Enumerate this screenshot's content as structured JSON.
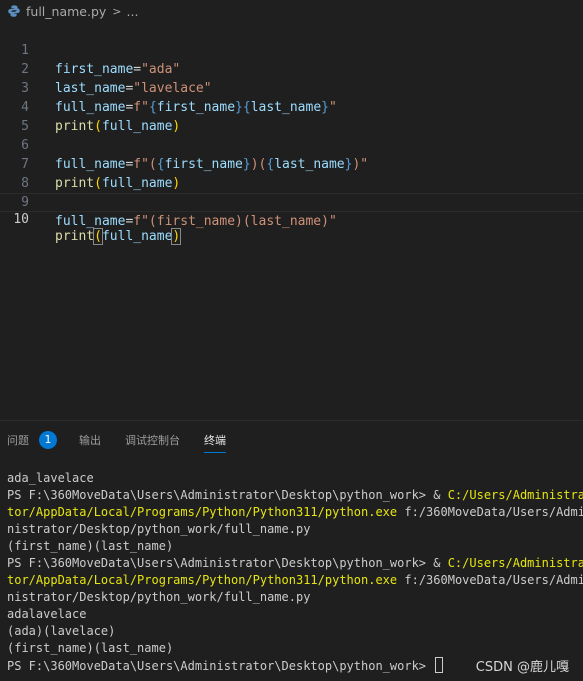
{
  "breadcrumb": {
    "file": "full_name.py",
    "chevron": ">",
    "more": "..."
  },
  "editor": {
    "line_numbers": [
      "1",
      "2",
      "3",
      "4",
      "5",
      "6",
      "7",
      "8",
      "9",
      "10"
    ],
    "lines": [
      [
        "first_name",
        "=",
        "\"ada\""
      ],
      [
        "last_name",
        "=",
        "\"lavelace\""
      ],
      [
        "full_name",
        "=",
        "f\"",
        "{",
        "first_name",
        "}",
        "{",
        "last_name",
        "}",
        "\""
      ],
      [
        "print",
        "(",
        "full_name",
        ")"
      ],
      [],
      [
        "full_name",
        "=",
        "f\"(",
        "{",
        "first_name",
        "}",
        ")(",
        "{",
        "last_name",
        "}",
        ")\""
      ],
      [
        "print",
        "(",
        "full_name",
        ")"
      ],
      [],
      [
        "full_name",
        "=",
        "f\"(first_name)(last_name)\""
      ],
      [
        "print",
        "(",
        "full_name",
        ")"
      ]
    ]
  },
  "panel": {
    "tabs": {
      "problems": "问题",
      "problems_count": "1",
      "output": "输出",
      "debug_console": "调试控制台",
      "terminal": "终端"
    }
  },
  "terminal": {
    "l1": "ada_lavelace",
    "l2_prompt": "PS F:\\360MoveData\\Users\\Administrator\\Desktop\\python_work> & ",
    "l2_exe": "C:/Users/Administra",
    "l3_exe": "tor/AppData/Local/Programs/Python/Python311/python.exe",
    "l3_arg": " f:/360MoveData/Users/Admi",
    "l4": "nistrator/Desktop/python_work/full_name.py",
    "l5": "(first_name)(last_name)",
    "l6_prompt": "PS F:\\360MoveData\\Users\\Administrator\\Desktop\\python_work> & ",
    "l6_exe": "C:/Users/Administra",
    "l7_exe": "tor/AppData/Local/Programs/Python/Python311/python.exe",
    "l7_arg": " f:/360MoveData/Users/Admi",
    "l8": "nistrator/Desktop/python_work/full_name.py",
    "l9": "adalavelace",
    "l10": "(ada)(lavelace)",
    "l11": "(first_name)(last_name)",
    "l12_prompt": "PS F:\\360MoveData\\Users\\Administrator\\Desktop\\python_work> "
  },
  "watermark": "CSDN @鹿儿嘎",
  "colors": {
    "background": "#1f1f1f",
    "variable": "#9cdcfe",
    "string": "#ce9178",
    "function": "#dcdcaa",
    "brace": "#569cd6",
    "paren": "#ffd700",
    "terminal_exe": "#e5e510",
    "accent": "#0078d4"
  }
}
